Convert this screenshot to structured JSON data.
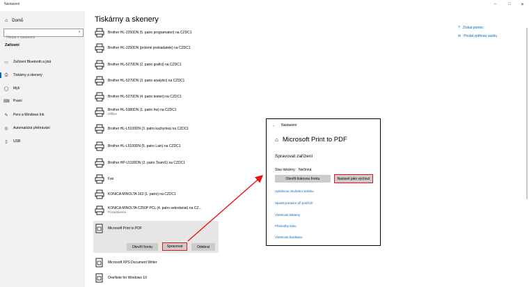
{
  "window": {
    "title": "Nastavení",
    "minimize": "–",
    "maximize": "□",
    "close": "✕"
  },
  "sidebar": {
    "home_label": "Domů",
    "search_placeholder": "Hledat v nastavení",
    "section_label": "Zařízení",
    "items": [
      {
        "label": "Zařízení Bluetooth a jiná",
        "icon": "bluetooth-icon",
        "glyph": "▭"
      },
      {
        "label": "Tiskárny a skenery",
        "icon": "printer-icon",
        "glyph": "⎙"
      },
      {
        "label": "Myš",
        "icon": "mouse-icon",
        "glyph": "◯"
      },
      {
        "label": "Psaní",
        "icon": "keyboard-icon",
        "glyph": "⌨"
      },
      {
        "label": "Pero a Windows Ink",
        "icon": "pen-icon",
        "glyph": "✎"
      },
      {
        "label": "Automatické přehrávání",
        "icon": "autoplay-icon",
        "glyph": "◎"
      },
      {
        "label": "USB",
        "icon": "usb-icon",
        "glyph": "▯"
      }
    ]
  },
  "main": {
    "title": "Tiskárny a skenery",
    "printers": [
      {
        "name": "Brother HL-2250DN (5. patro programatori) na CZDC1",
        "sub": ""
      },
      {
        "name": "Brother HL-2250DN (prizemi prekladatele) na CZDC1",
        "sub": ""
      },
      {
        "name": "Brother HL-5270DN (2. patro grafici) na CZDC1",
        "sub": ""
      },
      {
        "name": "Brother HL-5270DN (3. patro analytici) na CZDC1",
        "sub": ""
      },
      {
        "name": "Brother HL-5270DN (4. patro testeri) na CZDC1",
        "sub": ""
      },
      {
        "name": "Brother HL-5380DN (1. patro hw) na CZDC1",
        "sub": "Offline"
      },
      {
        "name": "Brother HL-L5100DN (3. patro kuchynka) na CZDC1",
        "sub": ""
      },
      {
        "name": "Brother HL-L5100DN (5. patro Lain) na CZDC1",
        "sub": ""
      },
      {
        "name": "Brother HP-L5100DN (2. patro TeamS) na CZDC1",
        "sub": ""
      },
      {
        "name": "Fax",
        "sub": ""
      },
      {
        "name": "KONICA MINOLTA 163 (1. patro) na CZDC1",
        "sub": ""
      },
      {
        "name": "KONICA MINOLTA C250P PCL (4. patro sekretariat) na CZ...",
        "sub": "Pozastavena"
      }
    ],
    "selected": {
      "name": "Microsoft Print to PDF",
      "open_queue": "Otevřít frontu",
      "manage": "Spravovat",
      "remove": "Odebrat"
    },
    "after": [
      {
        "name": "Microsoft XPS Document Writer"
      },
      {
        "name": "OneNote for Windows 10"
      }
    ],
    "right_links": [
      "Získat pomoc",
      "Poslat zpětnou vazbu"
    ]
  },
  "popup": {
    "back_label": "Nastavení",
    "title": "Microsoft Print to PDF",
    "manage_heading": "Spravovat zařízení",
    "state_label": "Stav tiskárny:",
    "state_value": "Nečinná",
    "open_queue_btn": "Otevřít tiskovou frontu",
    "set_default_btn": "Nastavit jako výchozí",
    "links": [
      "Vytisknout zkušební stránku",
      "Spustit poradce při potížích",
      "Vlastnosti tiskárny",
      "Předvolby tisku",
      "Vlastnosti hardwaru"
    ]
  },
  "colors": {
    "accent": "#0067c0",
    "highlight": "#e11111"
  }
}
